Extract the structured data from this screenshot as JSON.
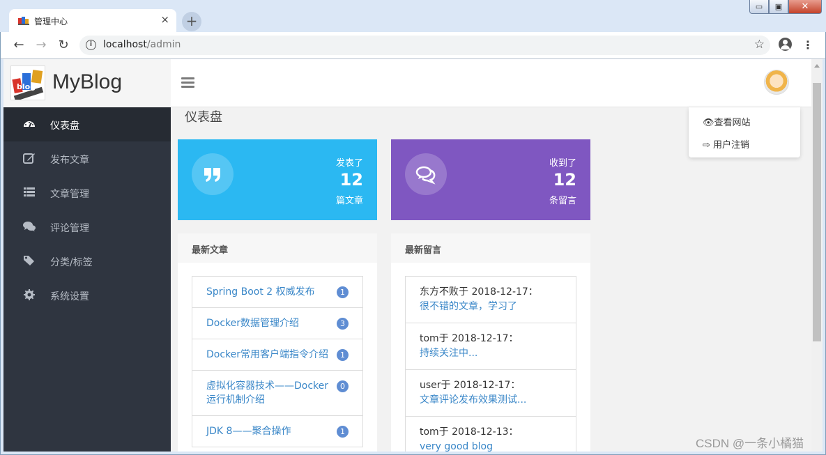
{
  "browser": {
    "tab_title": "管理中心",
    "tab_close": "×",
    "new_tab": "+",
    "url_host": "localhost",
    "url_path": "/admin"
  },
  "window_controls": {
    "minimize": "▭",
    "maximize": "▣",
    "close": "✕"
  },
  "brand": {
    "name": "MyBlog",
    "logo_text": "blog"
  },
  "sidebar": {
    "items": [
      {
        "label": "仪表盘",
        "icon": "dashboard-icon",
        "active": true
      },
      {
        "label": "发布文章",
        "icon": "edit-icon"
      },
      {
        "label": "文章管理",
        "icon": "list-icon"
      },
      {
        "label": "评论管理",
        "icon": "comments-icon"
      },
      {
        "label": "分类/标签",
        "icon": "tags-icon"
      },
      {
        "label": "系统设置",
        "icon": "gear-icon"
      }
    ]
  },
  "user_menu": {
    "items": [
      "查看网站",
      "用户注销"
    ]
  },
  "page": {
    "title": "仪表盘"
  },
  "stats": {
    "articles": {
      "top": "发表了",
      "value": "12",
      "bottom": "篇文章",
      "color": "#2bb8f2"
    },
    "comments": {
      "top": "收到了",
      "value": "12",
      "bottom": "条留言",
      "color": "#7f57c1"
    }
  },
  "latest_articles": {
    "title": "最新文章",
    "items": [
      {
        "title": "Spring Boot 2 权威发布",
        "count": "1"
      },
      {
        "title": "Docker数据管理介绍",
        "count": "3"
      },
      {
        "title": "Docker常用客户端指令介绍",
        "count": "1"
      },
      {
        "title": "虚拟化容器技术——Docker运行机制介绍",
        "count": "0"
      },
      {
        "title": "JDK 8——聚合操作",
        "count": "1"
      }
    ]
  },
  "latest_comments": {
    "title": "最新留言",
    "items": [
      {
        "meta": "东方不败于 2018-12-17：",
        "text": "很不错的文章，学习了"
      },
      {
        "meta": "tom于 2018-12-17：",
        "text": "持续关注中..."
      },
      {
        "meta": "user于 2018-12-17：",
        "text": "文章评论发布效果测试..."
      },
      {
        "meta": "tom于 2018-12-13：",
        "text": "very good blog"
      }
    ]
  },
  "watermark": "CSDN @一条小橘猫"
}
